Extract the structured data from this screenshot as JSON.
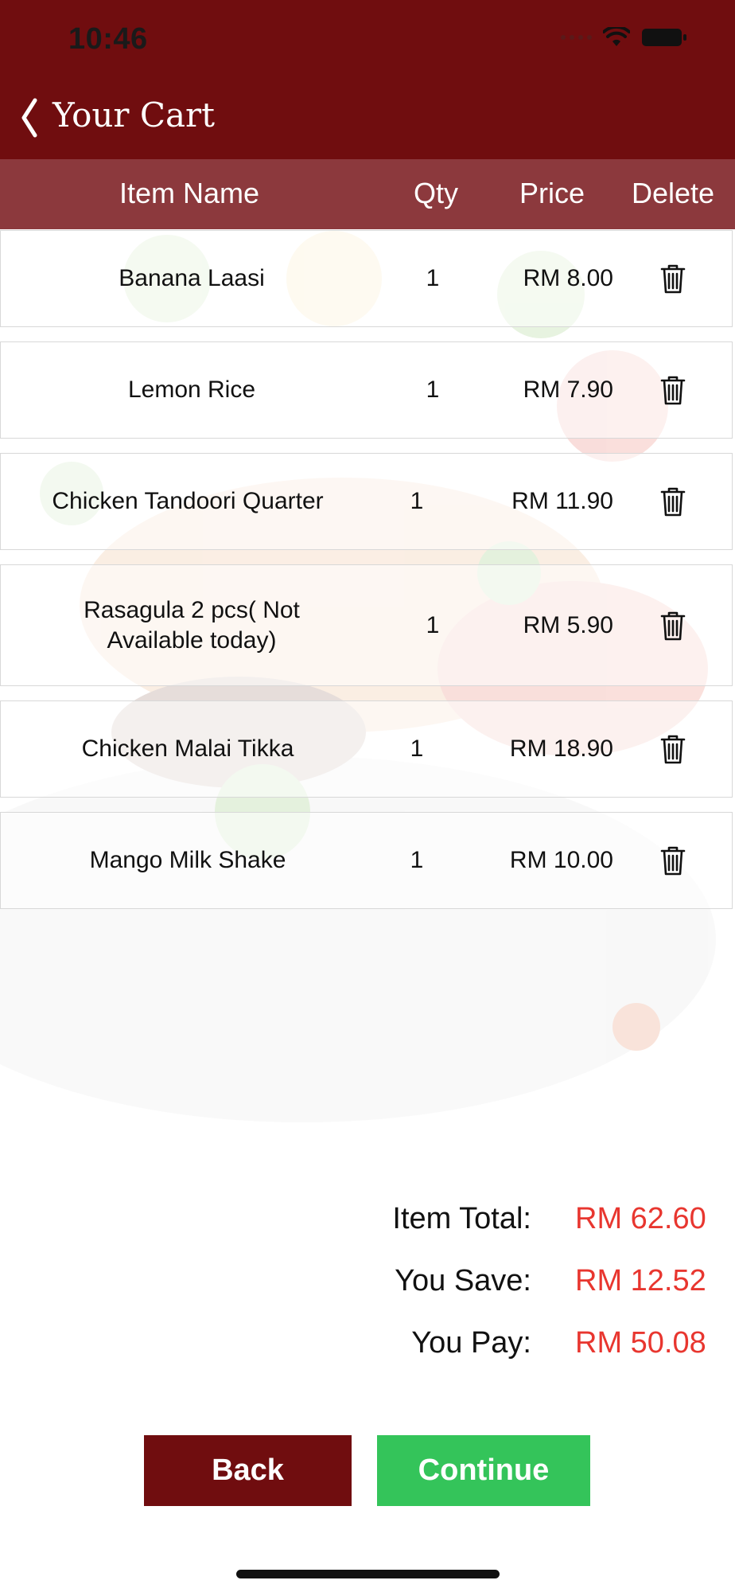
{
  "status_bar": {
    "time": "10:46"
  },
  "header": {
    "title": "Your Cart"
  },
  "table": {
    "columns": [
      "Item Name",
      "Qty",
      "Price",
      "Delete"
    ],
    "rows": [
      {
        "name": "Banana Laasi",
        "qty": "1",
        "price": "RM 8.00"
      },
      {
        "name": "Lemon Rice",
        "qty": "1",
        "price": "RM 7.90"
      },
      {
        "name": "Chicken Tandoori Quarter",
        "qty": "1",
        "price": "RM 11.90"
      },
      {
        "name": "Rasagula 2 pcs( Not Available today)",
        "qty": "1",
        "price": "RM 5.90"
      },
      {
        "name": "Chicken  Malai Tikka",
        "qty": "1",
        "price": "RM 18.90"
      },
      {
        "name": "Mango Milk Shake",
        "qty": "1",
        "price": "RM 10.00"
      }
    ]
  },
  "summary": {
    "item_total_label": "Item Total:",
    "item_total_value": "RM 62.60",
    "you_save_label": "You Save:",
    "you_save_value": "RM 12.52",
    "you_pay_label": "You Pay:",
    "you_pay_value": "RM 50.08"
  },
  "buttons": {
    "back": "Back",
    "continue": "Continue"
  },
  "colors": {
    "brand": "#700d0f",
    "header_row": "#82282c",
    "accent_value": "#e8362f",
    "continue": "#34c45a"
  },
  "icons": {
    "delete": "trash-icon",
    "back": "chevron-left-icon"
  }
}
